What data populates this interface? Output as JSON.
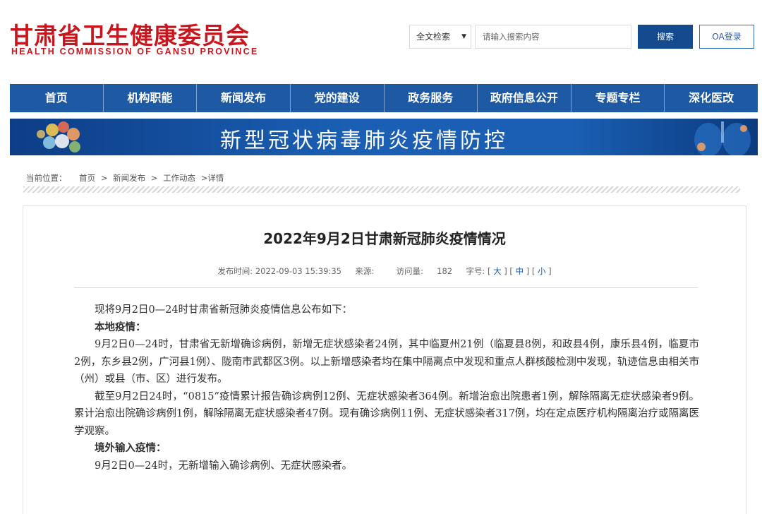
{
  "header": {
    "logo_cn": "甘肃省卫生健康委员会",
    "logo_en": "HEALTH COMMISSION OF GANSU PROVINCE",
    "search_scope": "全文检索",
    "search_placeholder": "请输入搜索内容",
    "search_button": "搜索",
    "oa_button": "OA登录"
  },
  "nav": {
    "items": [
      "首页",
      "机构职能",
      "新闻发布",
      "党的建设",
      "政务服务",
      "政府信息公开",
      "专题专栏",
      "深化医改"
    ]
  },
  "banner": {
    "title": "新型冠状病毒肺炎疫情防控"
  },
  "breadcrumb": {
    "label": "当前位置：",
    "home": "首页",
    "sep1": ">",
    "news": "新闻发布",
    "sep2": ">",
    "work": "工作动态",
    "detail": ">详情"
  },
  "article": {
    "title": "2022年9月2日甘肃新冠肺炎疫情情况",
    "meta": {
      "publish_label": "发布时间:",
      "publish_time": "2022-09-03 15:39:35",
      "source_label": "来源:",
      "views_label": "访问量:",
      "views": "182",
      "font_label": "字号:",
      "font_large": "大",
      "font_medium": "中",
      "font_small": "小"
    },
    "paragraphs": [
      "现将9月2日0—24时甘肃省新冠肺炎疫情信息公布如下：",
      "本地疫情：",
      "9月2日0—24时，甘肃省无新增确诊病例，新增无症状感染者24例，其中临夏州21例（临夏县8例，和政县4例，康乐县4例，临夏市2例，东乡县2例，广河县1例）、陇南市武都区3例。以上新增感染者均在集中隔离点中发现和重点人群核酸检测中发现，轨迹信息由相关市（州）或县（市、区）进行发布。",
      "截至9月2日24时，“0815”疫情累计报告确诊病例12例、无症状感染者364例。新增治愈出院患者1例，解除隔离无症状感染者9例。累计治愈出院确诊病例1例，解除隔离无症状感染者47例。现有确诊病例11例、无症状感染者317例，均在定点医疗机构隔离治疗或隔离医学观察。",
      "境外输入疫情：",
      "9月2日0—24时，无新增输入确诊病例、无症状感染者。"
    ]
  },
  "colors": {
    "brand_red": "#c8161e",
    "nav_blue": "#1e5aa4",
    "search_button_blue": "#144a8e"
  }
}
